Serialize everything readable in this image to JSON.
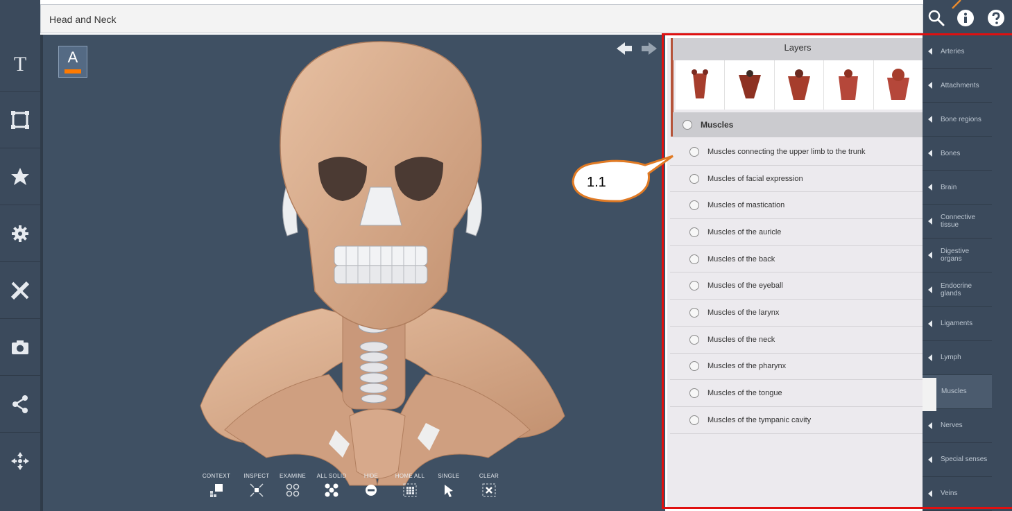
{
  "window": {
    "title": "Head and Neck"
  },
  "top_icons": [
    "search-icon",
    "info-icon",
    "help-icon"
  ],
  "left_toolbar": [
    "text-tool-icon",
    "frame-icon",
    "star-icon",
    "settings-icon",
    "ruler-pencil-icon",
    "camera-icon",
    "share-icon",
    "move-icon"
  ],
  "viewport": {
    "annotate_button": "A",
    "nav": [
      "back-arrow-icon",
      "forward-arrow-icon"
    ]
  },
  "bottom_toolbar": [
    {
      "label": "CONTEXT",
      "icon": "context-icon"
    },
    {
      "label": "INSPECT",
      "icon": "inspect-icon"
    },
    {
      "label": "EXAMINE",
      "icon": "examine-icon"
    },
    {
      "label": "ALL SOLID",
      "icon": "all-solid-icon"
    },
    {
      "label": "HIDE",
      "icon": "hide-icon"
    },
    {
      "label": "HOME ALL",
      "icon": "home-all-icon"
    },
    {
      "label": "SINGLE",
      "icon": "single-icon"
    },
    {
      "label": "CLEAR",
      "icon": "clear-icon"
    }
  ],
  "layers": {
    "header": "Layers",
    "group": "Muscles",
    "items": [
      "Muscles connecting the upper limb to the trunk",
      "Muscles of facial expression",
      "Muscles of mastication",
      "Muscles of the auricle",
      "Muscles of the back",
      "Muscles of the eyeball",
      "Muscles of the larynx",
      "Muscles of the neck",
      "Muscles of the pharynx",
      "Muscles of the tongue",
      "Muscles of the tympanic cavity"
    ]
  },
  "categories": [
    {
      "label": "Arteries",
      "active": false
    },
    {
      "label": "Attachments",
      "active": false
    },
    {
      "label": "Bone regions",
      "active": false
    },
    {
      "label": "Bones",
      "active": false
    },
    {
      "label": "Brain",
      "active": false
    },
    {
      "label": "Connective tissue",
      "active": false
    },
    {
      "label": "Digestive organs",
      "active": false
    },
    {
      "label": "Endocrine glands",
      "active": false
    },
    {
      "label": "Ligaments",
      "active": false
    },
    {
      "label": "Lymph",
      "active": false
    },
    {
      "label": "Muscles",
      "active": true
    },
    {
      "label": "Nerves",
      "active": false
    },
    {
      "label": "Special senses",
      "active": false
    },
    {
      "label": "Veins",
      "active": false
    }
  ],
  "annotation": {
    "callout_label": "1.1"
  },
  "colors": {
    "toolbar": "#3b4a5c",
    "viewport": "#3f5063",
    "bone": "#d9ab8d",
    "accent": "#ff7a00",
    "highlight": "#e01010"
  }
}
